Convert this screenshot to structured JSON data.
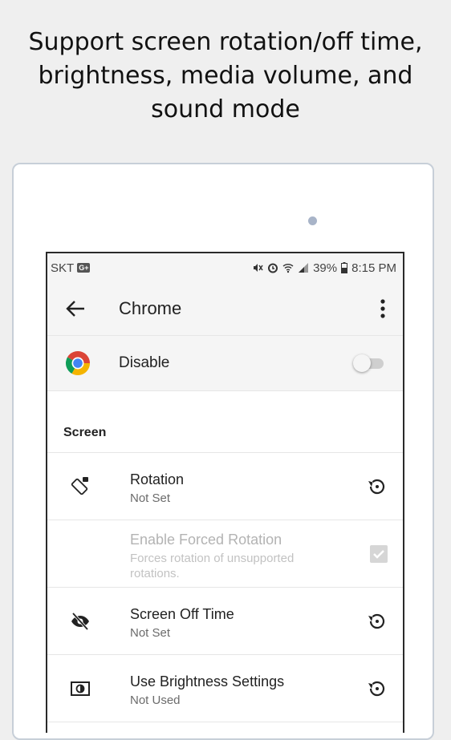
{
  "headline": {
    "line1": "Support screen rotation/off time,",
    "line2": "brightness, media volume, and",
    "line3": "sound mode"
  },
  "statusbar": {
    "carrier": "SKT",
    "network_badge": "G+",
    "battery": "39%",
    "time": "8:15 PM",
    "icons": [
      "mute-vibrate-icon",
      "alarm-icon",
      "wifi-icon",
      "signal-icon",
      "battery-icon"
    ]
  },
  "appbar": {
    "title": "Chrome",
    "back_icon": "arrow-back-icon",
    "menu_icon": "overflow-menu-icon"
  },
  "disable_row": {
    "label": "Disable",
    "enabled": false
  },
  "section": {
    "title": "Screen"
  },
  "items": [
    {
      "title": "Rotation",
      "subtitle": "Not Set",
      "icon": "screen-rotation-icon",
      "action": "reset-icon"
    },
    {
      "title": "Enable Forced Rotation",
      "subtitle": "Forces rotation of unsupported rotations.",
      "disabled": true,
      "checked": true
    },
    {
      "title": "Screen Off Time",
      "subtitle": "Not Set",
      "icon": "eye-off-icon",
      "action": "reset-icon"
    },
    {
      "title": "Use Brightness Settings",
      "subtitle": "Not Used",
      "icon": "brightness-icon",
      "action": "reset-icon"
    }
  ],
  "colors": {
    "background": "#efefef",
    "bar": "#f5f5f5",
    "text": "#222222",
    "secondary": "#6b6b6b",
    "disabled": "#b3b3b3",
    "tablet_border": "#c7cfd8"
  }
}
